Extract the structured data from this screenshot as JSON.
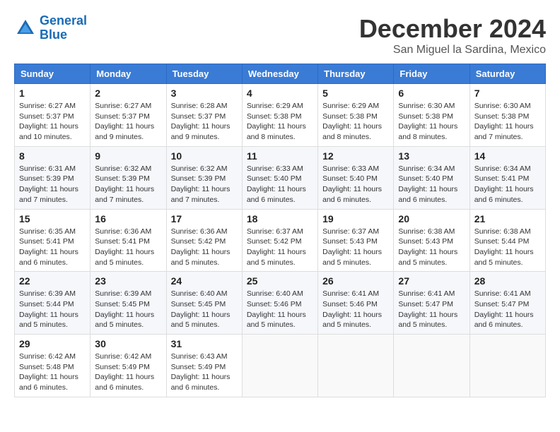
{
  "header": {
    "logo_line1": "General",
    "logo_line2": "Blue",
    "month_title": "December 2024",
    "location": "San Miguel la Sardina, Mexico"
  },
  "days_of_week": [
    "Sunday",
    "Monday",
    "Tuesday",
    "Wednesday",
    "Thursday",
    "Friday",
    "Saturday"
  ],
  "weeks": [
    [
      {
        "day": "1",
        "sunrise": "6:27 AM",
        "sunset": "5:37 PM",
        "daylight": "11 hours and 10 minutes."
      },
      {
        "day": "2",
        "sunrise": "6:27 AM",
        "sunset": "5:37 PM",
        "daylight": "11 hours and 9 minutes."
      },
      {
        "day": "3",
        "sunrise": "6:28 AM",
        "sunset": "5:37 PM",
        "daylight": "11 hours and 9 minutes."
      },
      {
        "day": "4",
        "sunrise": "6:29 AM",
        "sunset": "5:38 PM",
        "daylight": "11 hours and 8 minutes."
      },
      {
        "day": "5",
        "sunrise": "6:29 AM",
        "sunset": "5:38 PM",
        "daylight": "11 hours and 8 minutes."
      },
      {
        "day": "6",
        "sunrise": "6:30 AM",
        "sunset": "5:38 PM",
        "daylight": "11 hours and 8 minutes."
      },
      {
        "day": "7",
        "sunrise": "6:30 AM",
        "sunset": "5:38 PM",
        "daylight": "11 hours and 7 minutes."
      }
    ],
    [
      {
        "day": "8",
        "sunrise": "6:31 AM",
        "sunset": "5:39 PM",
        "daylight": "11 hours and 7 minutes."
      },
      {
        "day": "9",
        "sunrise": "6:32 AM",
        "sunset": "5:39 PM",
        "daylight": "11 hours and 7 minutes."
      },
      {
        "day": "10",
        "sunrise": "6:32 AM",
        "sunset": "5:39 PM",
        "daylight": "11 hours and 7 minutes."
      },
      {
        "day": "11",
        "sunrise": "6:33 AM",
        "sunset": "5:40 PM",
        "daylight": "11 hours and 6 minutes."
      },
      {
        "day": "12",
        "sunrise": "6:33 AM",
        "sunset": "5:40 PM",
        "daylight": "11 hours and 6 minutes."
      },
      {
        "day": "13",
        "sunrise": "6:34 AM",
        "sunset": "5:40 PM",
        "daylight": "11 hours and 6 minutes."
      },
      {
        "day": "14",
        "sunrise": "6:34 AM",
        "sunset": "5:41 PM",
        "daylight": "11 hours and 6 minutes."
      }
    ],
    [
      {
        "day": "15",
        "sunrise": "6:35 AM",
        "sunset": "5:41 PM",
        "daylight": "11 hours and 6 minutes."
      },
      {
        "day": "16",
        "sunrise": "6:36 AM",
        "sunset": "5:41 PM",
        "daylight": "11 hours and 5 minutes."
      },
      {
        "day": "17",
        "sunrise": "6:36 AM",
        "sunset": "5:42 PM",
        "daylight": "11 hours and 5 minutes."
      },
      {
        "day": "18",
        "sunrise": "6:37 AM",
        "sunset": "5:42 PM",
        "daylight": "11 hours and 5 minutes."
      },
      {
        "day": "19",
        "sunrise": "6:37 AM",
        "sunset": "5:43 PM",
        "daylight": "11 hours and 5 minutes."
      },
      {
        "day": "20",
        "sunrise": "6:38 AM",
        "sunset": "5:43 PM",
        "daylight": "11 hours and 5 minutes."
      },
      {
        "day": "21",
        "sunrise": "6:38 AM",
        "sunset": "5:44 PM",
        "daylight": "11 hours and 5 minutes."
      }
    ],
    [
      {
        "day": "22",
        "sunrise": "6:39 AM",
        "sunset": "5:44 PM",
        "daylight": "11 hours and 5 minutes."
      },
      {
        "day": "23",
        "sunrise": "6:39 AM",
        "sunset": "5:45 PM",
        "daylight": "11 hours and 5 minutes."
      },
      {
        "day": "24",
        "sunrise": "6:40 AM",
        "sunset": "5:45 PM",
        "daylight": "11 hours and 5 minutes."
      },
      {
        "day": "25",
        "sunrise": "6:40 AM",
        "sunset": "5:46 PM",
        "daylight": "11 hours and 5 minutes."
      },
      {
        "day": "26",
        "sunrise": "6:41 AM",
        "sunset": "5:46 PM",
        "daylight": "11 hours and 5 minutes."
      },
      {
        "day": "27",
        "sunrise": "6:41 AM",
        "sunset": "5:47 PM",
        "daylight": "11 hours and 5 minutes."
      },
      {
        "day": "28",
        "sunrise": "6:41 AM",
        "sunset": "5:47 PM",
        "daylight": "11 hours and 6 minutes."
      }
    ],
    [
      {
        "day": "29",
        "sunrise": "6:42 AM",
        "sunset": "5:48 PM",
        "daylight": "11 hours and 6 minutes."
      },
      {
        "day": "30",
        "sunrise": "6:42 AM",
        "sunset": "5:49 PM",
        "daylight": "11 hours and 6 minutes."
      },
      {
        "day": "31",
        "sunrise": "6:43 AM",
        "sunset": "5:49 PM",
        "daylight": "11 hours and 6 minutes."
      },
      null,
      null,
      null,
      null
    ]
  ]
}
